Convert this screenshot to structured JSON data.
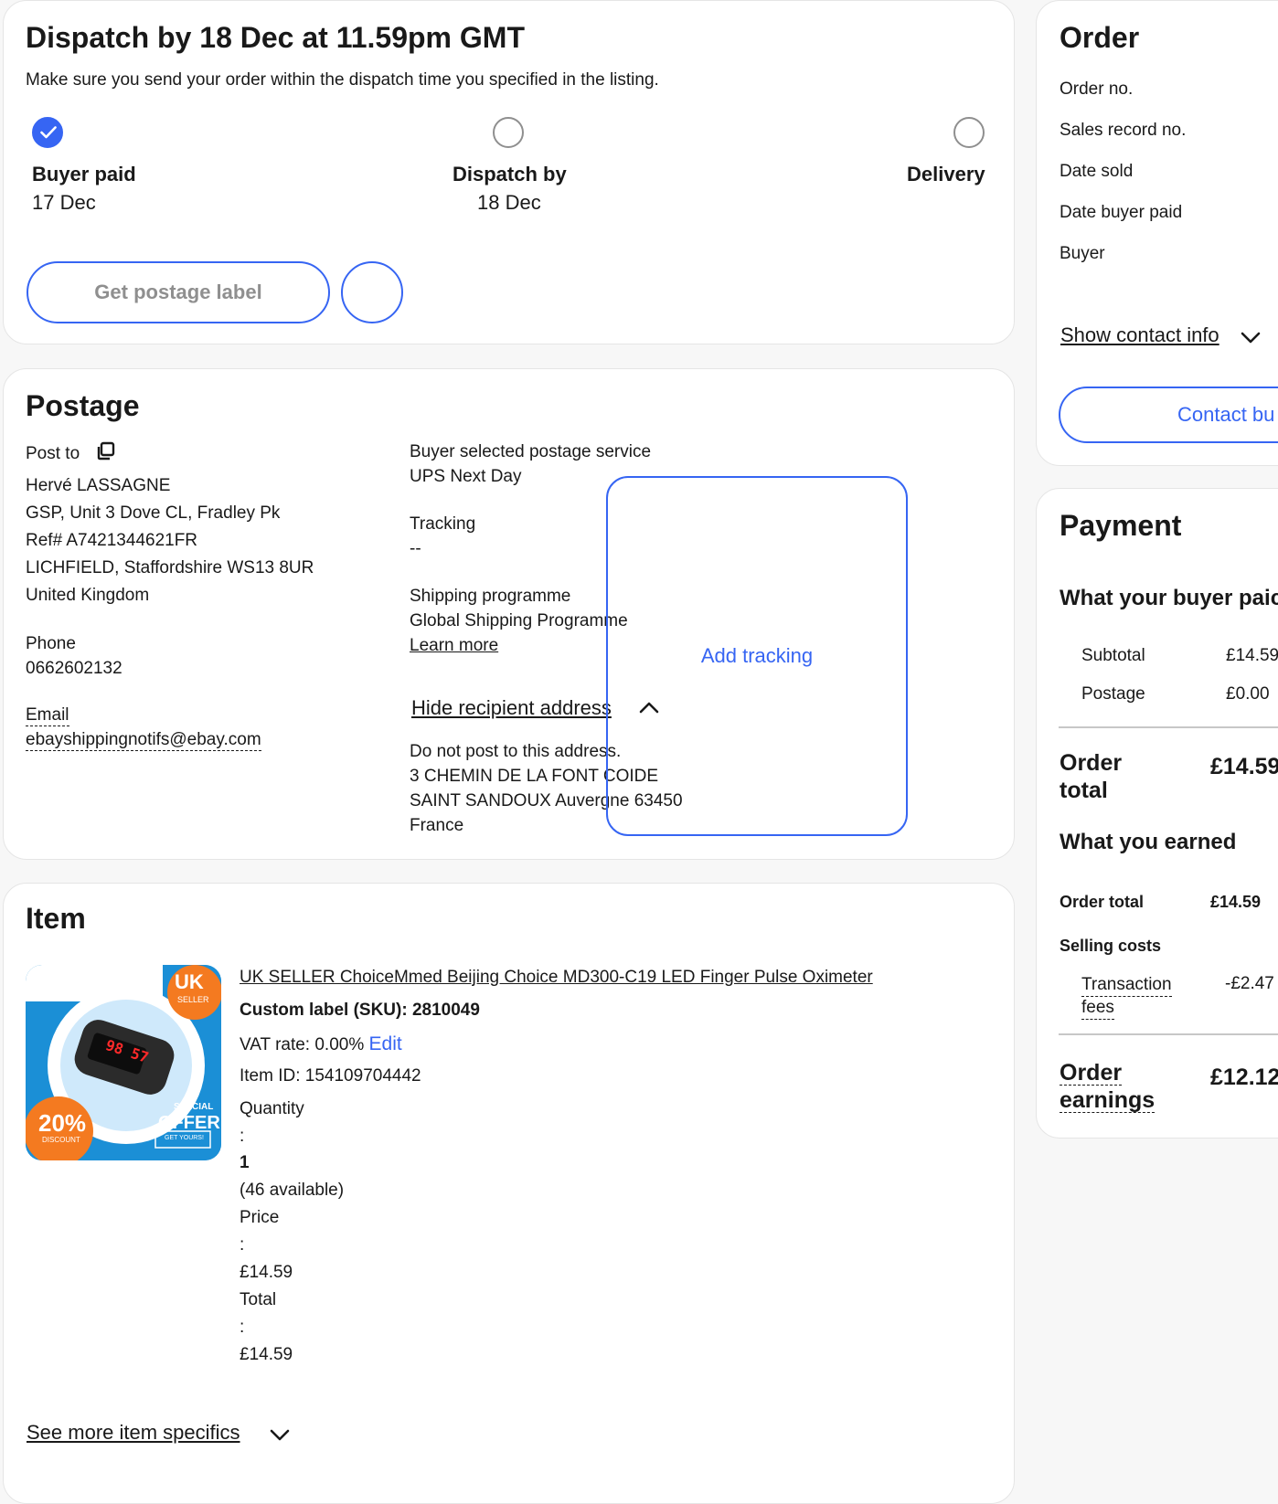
{
  "dispatch": {
    "title": "Dispatch by 18 Dec at 11.59pm GMT",
    "subtitle": "Make sure you send your order within the dispatch time you specified in the listing.",
    "steps": [
      {
        "label": "Buyer paid",
        "date": "17 Dec",
        "status": "done"
      },
      {
        "label": "Dispatch by",
        "date": "18 Dec",
        "status": "pending"
      },
      {
        "label": "Delivery",
        "date": "",
        "status": "pending"
      }
    ],
    "get_label_button": "Get postage label"
  },
  "postage": {
    "title": "Postage",
    "post_to_label": "Post to",
    "address_lines": [
      "Hervé LASSAGNE",
      "GSP, Unit 3 Dove CL, Fradley Pk",
      "Ref# A7421344621FR",
      "LICHFIELD, Staffordshire WS13 8UR",
      "United Kingdom"
    ],
    "phone_label": "Phone",
    "phone": "0662602132",
    "email_label": "Email",
    "email": "ebayshippingnotifs@ebay.com",
    "service_label": "Buyer selected postage service",
    "service": "UPS Next Day",
    "tracking_label": "Tracking",
    "tracking": "--",
    "programme_label": "Shipping programme",
    "programme": "Global Shipping Programme",
    "learn_more": "Learn more",
    "hide_address": "Hide recipient address",
    "recipient_lines": [
      "Do not post to this address.",
      "3 CHEMIN DE LA FONT COIDE",
      "SAINT SANDOUX Auvergne 63450",
      "France"
    ],
    "add_tracking": "Add tracking"
  },
  "item": {
    "title": "Item",
    "name": "UK SELLER ChoiceMmed Beijing Choice MD300-C19 LED Finger Pulse Oximeter",
    "sku": "Custom label (SKU): 2810049",
    "vat": "VAT rate: 0.00%",
    "vat_edit": "Edit",
    "item_id": "Item ID: 154109704442",
    "quantity_label": "Quantity",
    "colon": ":",
    "quantity": "1",
    "available": "(46 available)",
    "price_label": "Price",
    "price": "£14.59",
    "total_label": "Total",
    "total": "£14.59",
    "see_more": "See more item specifics",
    "thumb": {
      "badge_top": "UK",
      "badge_top_sub": "SELLER",
      "discount": "20%",
      "discount_sub": "DISCOUNT",
      "special": "SPECIAL",
      "offer": "OFFER",
      "get_yours": "GET YOURS!",
      "device_display": "98 57"
    }
  },
  "order": {
    "title": "Order",
    "fields": [
      "Order no.",
      "Sales record no.",
      "Date sold",
      "Date buyer paid",
      "Buyer"
    ],
    "show_contact": "Show contact info",
    "contact_button": "Contact bu"
  },
  "payment": {
    "title": "Payment",
    "buyer_paid_heading": "What your buyer paic",
    "subtotal_label": "Subtotal",
    "subtotal": "£14.59",
    "postage_label": "Postage",
    "postage": "£0.00",
    "order_total_label_1": "Order",
    "order_total_label_2": "total",
    "order_total": "£14.59",
    "earned_heading": "What you earned",
    "earned_total_label": "Order total",
    "earned_total": "£14.59",
    "selling_costs_label": "Selling costs",
    "transaction_label_1": "Transaction",
    "transaction_label_2": "fees",
    "transaction": "-£2.47",
    "earnings_label_1": "Order",
    "earnings_label_2": "earnings",
    "earnings": "£12.12"
  },
  "colors": {
    "accent": "#3665f3",
    "text": "#191919",
    "muted": "#8f8f8f"
  }
}
